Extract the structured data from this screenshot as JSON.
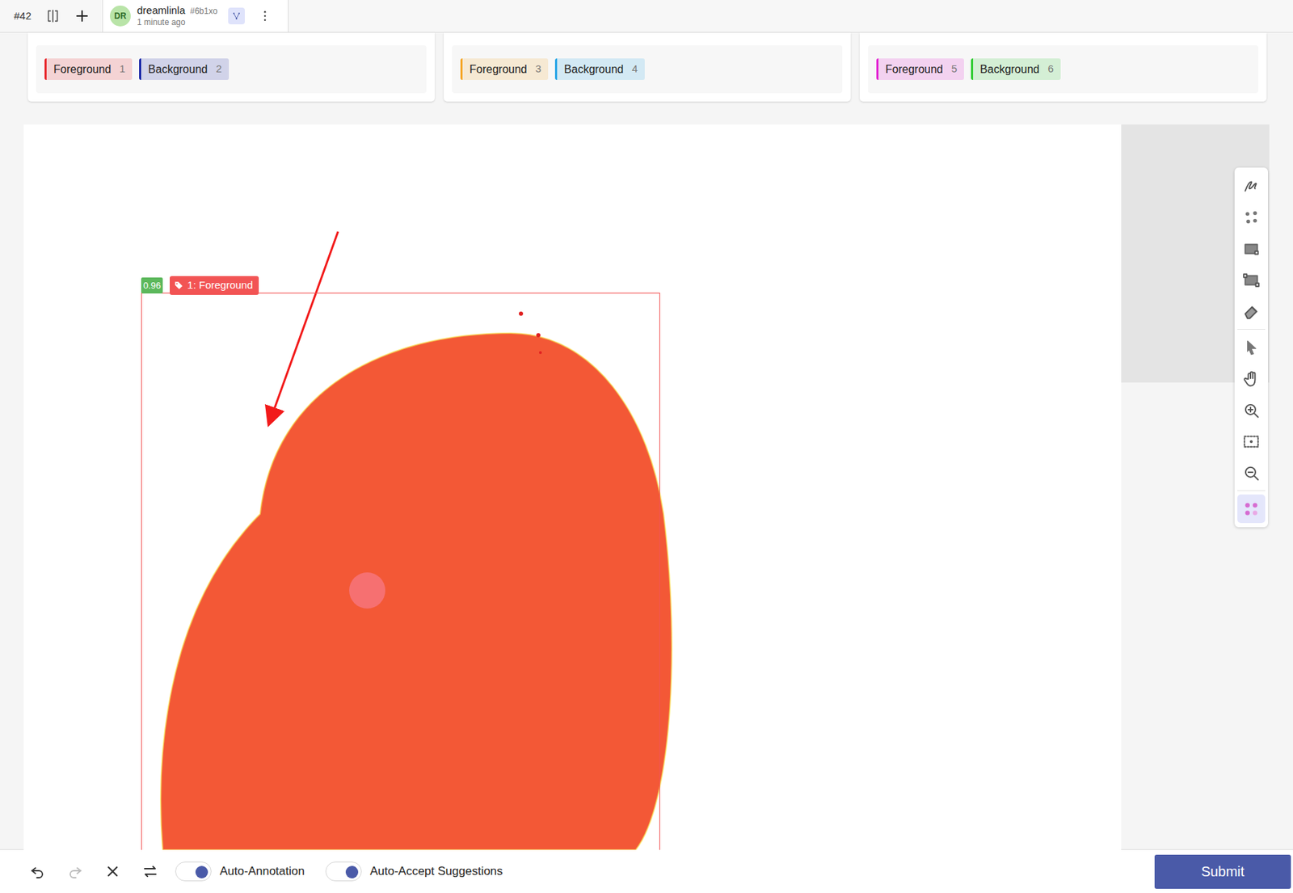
{
  "topbar": {
    "task": "#42",
    "tab": {
      "avatar": "DR",
      "user": "dreamlinla",
      "id": "#6b1xo",
      "time": "1 minute ago"
    }
  },
  "label_groups": [
    {
      "labels": [
        {
          "text": "Foreground",
          "hotkey": "1",
          "color": "#e8262b"
        },
        {
          "text": "Background",
          "hotkey": "2",
          "color": "#1523a6"
        }
      ]
    },
    {
      "labels": [
        {
          "text": "Foreground",
          "hotkey": "3",
          "color": "#f5a524"
        },
        {
          "text": "Background",
          "hotkey": "4",
          "color": "#25a4e6"
        }
      ]
    },
    {
      "labels": [
        {
          "text": "Foreground",
          "hotkey": "5",
          "color": "#e21fd2"
        },
        {
          "text": "Background",
          "hotkey": "6",
          "color": "#2ccb2f"
        }
      ]
    }
  ],
  "annotation": {
    "score": "0.96",
    "label": "1: Foreground",
    "color": "#f25454"
  },
  "tools": [
    {
      "selected": false
    },
    {
      "selected": false
    },
    {
      "selected": false
    },
    {
      "selected": false
    },
    {
      "selected": false
    },
    {
      "selected": false
    },
    {
      "selected": false
    },
    {
      "selected": false
    },
    {
      "selected": false
    },
    {
      "selected": false
    },
    {
      "selected": true
    }
  ],
  "history": {
    "undo_disabled": false,
    "redo_disabled": true
  },
  "toggles": [
    {
      "label": "Auto-Annotation",
      "on": true
    },
    {
      "label": "Auto-Accept Suggestions",
      "on": true
    }
  ],
  "submit": "Submit"
}
